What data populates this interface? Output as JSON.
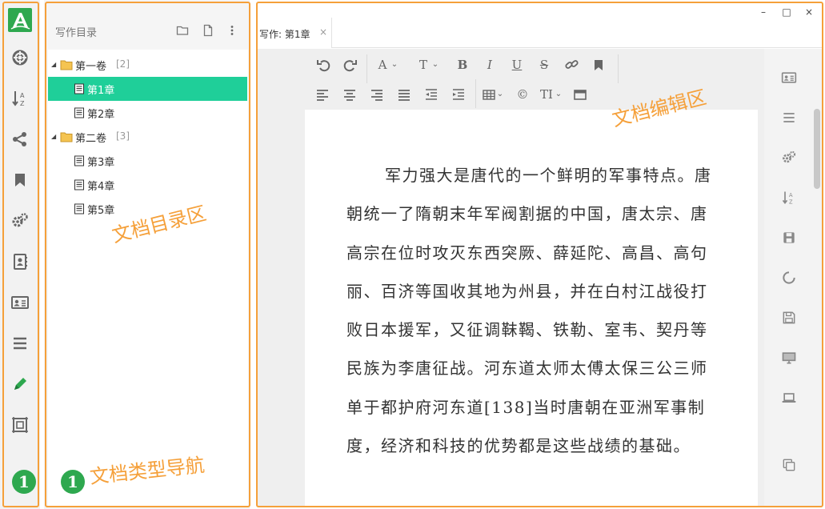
{
  "rail": {
    "logo": "app-logo-icon",
    "icons": [
      "lifebuoy-icon",
      "sort-az-icon",
      "share-icon",
      "bookmark-icon",
      "gears-icon",
      "contact-book-icon",
      "id-card-icon",
      "menu-icon",
      "pencil-icon",
      "frame-icon"
    ],
    "badge": "1"
  },
  "directory": {
    "title": "写作目录",
    "header_icons": [
      "folder-icon",
      "new-file-icon",
      "more-vertical-icon"
    ],
    "tree": [
      {
        "type": "volume",
        "label": "第一卷",
        "count": "[2]"
      },
      {
        "type": "chapter",
        "label": "第1章",
        "selected": true
      },
      {
        "type": "chapter",
        "label": "第2章"
      },
      {
        "type": "volume",
        "label": "第二卷",
        "count": "[3]"
      },
      {
        "type": "chapter",
        "label": "第3章"
      },
      {
        "type": "chapter",
        "label": "第4章"
      },
      {
        "type": "chapter",
        "label": "第5章"
      }
    ],
    "annotation": "文档目录区",
    "nav_badge": "1",
    "nav_annotation": "文档类型导航"
  },
  "editor": {
    "tab_label": "写作: 第1章",
    "tab_close": "×",
    "window_controls": [
      "–",
      "□",
      "×"
    ],
    "annotation": "文档编辑区",
    "toolbar": {
      "row1": [
        "undo-icon",
        "redo-icon",
        "font-color-icon",
        "font-size-icon",
        "bold-icon",
        "italic-icon",
        "underline-icon",
        "strikethrough-icon",
        "link-icon",
        "bookmark-icon"
      ],
      "row1_text": {
        "font": "A",
        "size": "T",
        "bold": "B",
        "italic": "I",
        "underline": "U",
        "strike": "S"
      },
      "row2": [
        "align-left-icon",
        "align-center-icon",
        "align-right-icon",
        "justify-icon",
        "outdent-icon",
        "indent-icon",
        "table-icon",
        "copyright-icon",
        "text-style-icon",
        "fullscreen-icon"
      ],
      "row2_text": {
        "copyright": "©",
        "textstyle": "TI"
      }
    },
    "content": "军力强大是唐代的一个鲜明的军事特点。唐朝统一了隋朝末年军阀割据的中国，唐太宗、唐高宗在位时攻灭东西突厥、薛延陀、高昌、高句丽、百济等国收其地为州县，并在白村江战役打败日本援军，又征调靺鞨、铁勒、室韦、契丹等民族为李唐征战。河东道太师太傅太保三公三师单于都护府河东道[138]当时唐朝在亚洲军事制度，经济和科技的优势都是这些战绩的基础。"
  },
  "right_sidebar": {
    "icons": [
      "id-card-icon",
      "menu-icon",
      "gears-icon",
      "sort-az-icon",
      "save-box-icon",
      "refresh-icon",
      "floppy-icon",
      "monitor-icon",
      "laptop-icon",
      "copy-icon"
    ]
  },
  "colors": {
    "accent": "#f5a03a",
    "brand_green": "#2ea84f",
    "selection": "#1fcf99"
  }
}
